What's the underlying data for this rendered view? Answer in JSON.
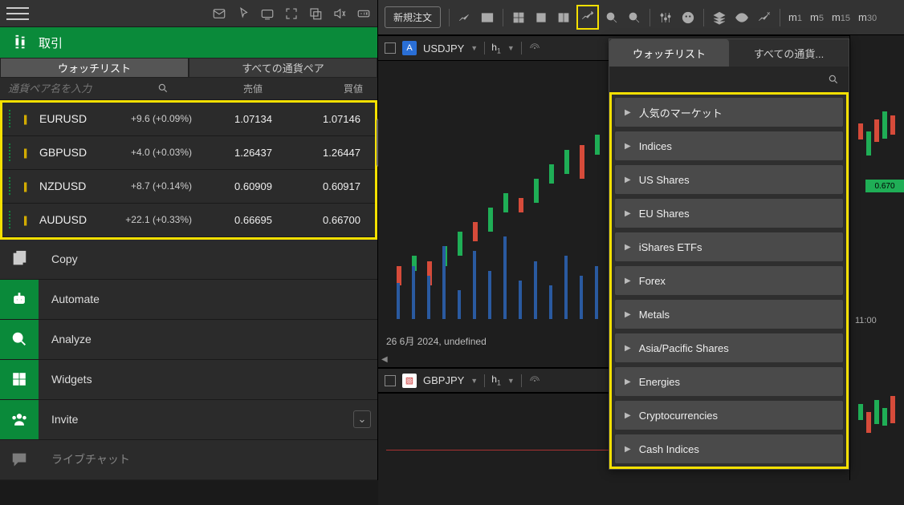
{
  "left": {
    "trade_label": "取引",
    "tabs": {
      "watchlist": "ウォッチリスト",
      "all_pairs": "すべての通貨ペア"
    },
    "search": {
      "placeholder": "通貨ペア名を入力"
    },
    "headers": {
      "sell": "売値",
      "buy": "買値"
    },
    "pairs": [
      {
        "symbol": "EURUSD",
        "change": "+9.6 (+0.09%)",
        "sell": "1.07134",
        "buy": "1.07146"
      },
      {
        "symbol": "GBPUSD",
        "change": "+4.0 (+0.03%)",
        "sell": "1.26437",
        "buy": "1.26447"
      },
      {
        "symbol": "NZDUSD",
        "change": "+8.7 (+0.14%)",
        "sell": "0.60909",
        "buy": "0.60917"
      },
      {
        "symbol": "AUDUSD",
        "change": "+22.1 (+0.33%)",
        "sell": "0.66695",
        "buy": "0.66700"
      }
    ],
    "menu": {
      "copy": "Copy",
      "automate": "Automate",
      "analyze": "Analyze",
      "widgets": "Widgets",
      "invite": "Invite",
      "livechat": "ライブチャット"
    }
  },
  "right": {
    "new_order": "新規注文",
    "m_indicators": [
      "1",
      "5",
      "15",
      "30"
    ],
    "chart1": {
      "badge": "A",
      "symbol": "USDJPY",
      "tf": "h",
      "tf_sub": "1",
      "date": "26 6月 2024, undefined"
    },
    "chart2": {
      "badge": "▧",
      "symbol": "GBPJPY",
      "tf": "h",
      "tf_sub": "1"
    },
    "popup": {
      "tabs": {
        "watchlist": "ウォッチリスト",
        "all": "すべての通貨..."
      },
      "categories": [
        "人気のマーケット",
        "Indices",
        "US Shares",
        "EU Shares",
        "iShares ETFs",
        "Forex",
        "Metals",
        "Asia/Pacific Shares",
        "Energies",
        "Cryptocurrencies",
        "Cash Indices"
      ]
    },
    "strip": {
      "price": "0.670",
      "time": "11:00"
    }
  }
}
